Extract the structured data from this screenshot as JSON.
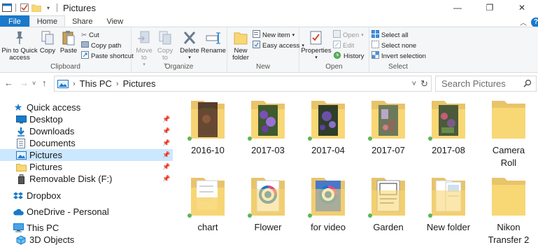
{
  "window": {
    "title": "Pictures",
    "minimize": "—",
    "maximize": "❐",
    "close": "✕"
  },
  "ribbon_tabs": [
    "File",
    "Home",
    "Share",
    "View"
  ],
  "ribbon": {
    "clipboard": {
      "label": "Clipboard",
      "pin": "Pin to Quick access",
      "copy": "Copy",
      "paste": "Paste",
      "cut": "Cut",
      "copy_path": "Copy path",
      "paste_shortcut": "Paste shortcut"
    },
    "organize": {
      "label": "Organize",
      "move_to": "Move to",
      "copy_to": "Copy to",
      "delete": "Delete",
      "rename": "Rename"
    },
    "new": {
      "label": "New",
      "new_folder": "New folder",
      "new_item": "New item",
      "easy_access": "Easy access"
    },
    "open": {
      "label": "Open",
      "properties": "Properties",
      "open": "Open",
      "edit": "Edit",
      "history": "History"
    },
    "select": {
      "label": "Select",
      "select_all": "Select all",
      "select_none": "Select none",
      "invert_selection": "Invert selection"
    }
  },
  "address": {
    "path": [
      "This PC",
      "Pictures"
    ],
    "search_placeholder": "Search Pictures"
  },
  "nav": [
    {
      "label": "Quick access",
      "icon": "star-icon"
    },
    {
      "label": "Desktop",
      "icon": "desktop-icon",
      "pinned": true
    },
    {
      "label": "Downloads",
      "icon": "download-icon",
      "pinned": true
    },
    {
      "label": "Documents",
      "icon": "documents-icon",
      "pinned": true
    },
    {
      "label": "Pictures",
      "icon": "pictures-icon",
      "pinned": true,
      "selected": true
    },
    {
      "label": "Pictures",
      "icon": "folder-icon",
      "pinned": true
    },
    {
      "label": "Removable Disk (F:)",
      "icon": "usb-drive-icon",
      "pinned": true
    },
    {
      "label": "Dropbox",
      "icon": "dropbox-icon"
    },
    {
      "label": "OneDrive - Personal",
      "icon": "cloud-icon"
    },
    {
      "label": "This PC",
      "icon": "computer-icon"
    },
    {
      "label": "3D Objects",
      "icon": "cube-icon"
    }
  ],
  "pin_glyph": "📌",
  "folders": [
    {
      "name": "2016-10",
      "preview": "photo",
      "tone": "#5a3b2e"
    },
    {
      "name": "2017-03",
      "preview": "photo",
      "tone": "#7a4fb8"
    },
    {
      "name": "2017-04",
      "preview": "photo",
      "tone": "#6b50a8"
    },
    {
      "name": "2017-07",
      "preview": "photo",
      "tone": "#8a6b5a"
    },
    {
      "name": "2017-08",
      "preview": "photo",
      "tone": "#7a5a8a"
    },
    {
      "name": "Camera\nRoll",
      "preview": "none"
    },
    {
      "name": "chart",
      "preview": "doc"
    },
    {
      "name": "Flower",
      "preview": "logo"
    },
    {
      "name": "for video",
      "preview": "logo"
    },
    {
      "name": "Garden",
      "preview": "doc"
    },
    {
      "name": "New folder",
      "preview": "doc"
    },
    {
      "name": "Nikon\nTransfer 2",
      "preview": "none"
    }
  ],
  "colors": {
    "accent": "#1979ca",
    "selection": "#cce8ff",
    "folder_back": "#e8c46a",
    "folder_front": "#f8d775",
    "sync_green": "#5bb55b"
  }
}
